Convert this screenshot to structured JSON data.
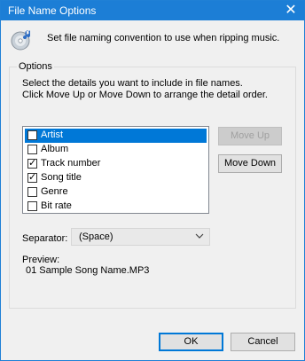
{
  "window": {
    "title": "File Name Options",
    "close_glyph": "✕"
  },
  "header": {
    "text": "Set file naming convention to use when ripping music.",
    "icon": "cd-music-icon"
  },
  "options": {
    "group_label": "Options",
    "instruction_1": "Select the details you want to include in file names.",
    "instruction_2": "Click Move Up or Move Down to arrange the detail order.",
    "details": [
      {
        "label": "Artist",
        "checked": false,
        "selected": true
      },
      {
        "label": "Album",
        "checked": false,
        "selected": false
      },
      {
        "label": "Track number",
        "checked": true,
        "selected": false
      },
      {
        "label": "Song title",
        "checked": true,
        "selected": false
      },
      {
        "label": "Genre",
        "checked": false,
        "selected": false
      },
      {
        "label": "Bit rate",
        "checked": false,
        "selected": false
      }
    ],
    "move_up_label": "Move Up",
    "move_down_label": "Move Down",
    "separator_label": "Separator:",
    "separator_value": "(Space)",
    "preview_label": "Preview:",
    "preview_value": "01 Sample Song Name.MP3"
  },
  "footer": {
    "ok_label": "OK",
    "cancel_label": "Cancel"
  }
}
